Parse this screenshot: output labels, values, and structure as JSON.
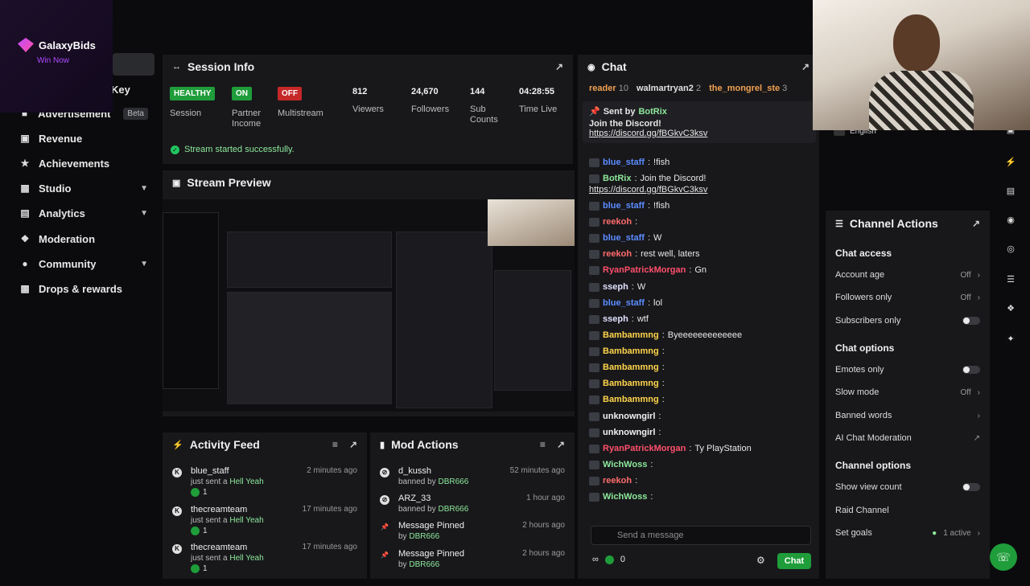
{
  "overlay": {
    "brand": "GalaxyBids",
    "tagline": "Win Now"
  },
  "sidebar": {
    "key_label": "Key",
    "items": [
      {
        "label": "Advertisement",
        "icon": "megaphone-icon",
        "badge": "Beta"
      },
      {
        "label": "Revenue",
        "icon": "chart-icon"
      },
      {
        "label": "Achievements",
        "icon": "trophy-icon"
      },
      {
        "label": "Studio",
        "icon": "film-icon"
      },
      {
        "label": "Analytics",
        "icon": "bar-chart-icon"
      },
      {
        "label": "Moderation",
        "icon": "wrench-icon"
      },
      {
        "label": "Community",
        "icon": "people-icon"
      },
      {
        "label": "Drops & rewards",
        "icon": "gift-icon"
      }
    ]
  },
  "session": {
    "title": "Session Info",
    "stats": [
      {
        "value": "HEALTHY",
        "label": "Session",
        "kind": "badge-green"
      },
      {
        "value": "ON",
        "label": "Partner Income",
        "kind": "badge-green"
      },
      {
        "value": "OFF",
        "label": "Multistream",
        "kind": "badge-red"
      },
      {
        "value": "812",
        "label": "Viewers",
        "kind": "text"
      },
      {
        "value": "24,670",
        "label": "Followers",
        "kind": "text"
      },
      {
        "value": "144",
        "label": "Sub Counts",
        "kind": "text"
      },
      {
        "value": "04:28:55",
        "label": "Time Live",
        "kind": "text"
      }
    ],
    "status": "Stream started successfully."
  },
  "preview": {
    "title": "Stream Preview"
  },
  "activity": {
    "title": "Activity Feed",
    "items": [
      {
        "name": "blue_staff",
        "action": "just sent a",
        "item": "Hell Yeah",
        "count": "1",
        "time": "2 minutes ago"
      },
      {
        "name": "thecreamteam",
        "action": "just sent a",
        "item": "Hell Yeah",
        "count": "1",
        "time": "17 minutes ago"
      },
      {
        "name": "thecreamteam",
        "action": "just sent a",
        "item": "Hell Yeah",
        "count": "1",
        "time": "17 minutes ago"
      }
    ]
  },
  "mod": {
    "title": "Mod Actions",
    "items": [
      {
        "name": "d_kussh",
        "action": "banned by",
        "by": "DBR666",
        "time": "52 minutes ago",
        "icon": "ban-icon"
      },
      {
        "name": "ARZ_33",
        "action": "banned by",
        "by": "DBR666",
        "time": "1 hour ago",
        "icon": "ban-icon"
      },
      {
        "name": "Message Pinned",
        "action": "by",
        "by": "DBR666",
        "time": "2 hours ago",
        "icon": "pin-icon"
      },
      {
        "name": "Message Pinned",
        "action": "by",
        "by": "DBR666",
        "time": "2 hours ago",
        "icon": "pin-icon"
      }
    ]
  },
  "chat": {
    "title": "Chat",
    "leaderboard": [
      {
        "name": "reader",
        "count": "10"
      },
      {
        "name": "walmartryan2",
        "count": "2"
      },
      {
        "name": "the_mongrel_ste",
        "count": "3"
      }
    ],
    "pinned": {
      "sent_by": "Sent by",
      "author": "BotRix",
      "text": "Join the Discord!",
      "link": "https://discord.gg/fBGkvC3ksv"
    },
    "messages": [
      {
        "user": "blue_staff",
        "text": "!fish",
        "color": "#5b8cff"
      },
      {
        "user": "BotRix",
        "text": "Join the Discord!",
        "color": "#8ee99b",
        "link": "https://discord.gg/fBGkvC3ksv"
      },
      {
        "user": "blue_staff",
        "text": "!fish",
        "color": "#5b8cff"
      },
      {
        "user": "reekoh",
        "text": "",
        "color": "#ff6b6b"
      },
      {
        "user": "blue_staff",
        "text": "W",
        "color": "#5b8cff"
      },
      {
        "user": "reekoh",
        "text": "rest well, laters",
        "color": "#ff6b6b"
      },
      {
        "user": "RyanPatrickMorgan",
        "text": "Gn",
        "color": "#ff4f6a"
      },
      {
        "user": "sseph",
        "text": "W",
        "color": "#e0e0ff"
      },
      {
        "user": "blue_staff",
        "text": "lol",
        "color": "#5b8cff"
      },
      {
        "user": "sseph",
        "text": "wtf",
        "color": "#e0e0ff"
      },
      {
        "user": "Bambammng",
        "text": "Byeeeeeeeeeeeee",
        "color": "#ffd54a"
      },
      {
        "user": "Bambammng",
        "text": "",
        "color": "#ffd54a"
      },
      {
        "user": "Bambammng",
        "text": "",
        "color": "#ffd54a"
      },
      {
        "user": "Bambammng",
        "text": "",
        "color": "#ffd54a"
      },
      {
        "user": "Bambammng",
        "text": "",
        "color": "#ffd54a"
      },
      {
        "user": "unknowngirl",
        "text": "",
        "color": "#f2f2f2"
      },
      {
        "user": "unknowngirl",
        "text": "",
        "color": "#f2f2f2"
      },
      {
        "user": "RyanPatrickMorgan",
        "text": "Ty PlayStation",
        "color": "#ff4f6a"
      },
      {
        "user": "WichWoss",
        "text": "",
        "color": "#8ee99b"
      },
      {
        "user": "reekoh",
        "text": "",
        "color": "#ff6b6b"
      },
      {
        "user": "WichWoss",
        "text": "",
        "color": "#8ee99b"
      }
    ],
    "input_placeholder": "Send a message",
    "points": "0",
    "send_label": "Chat"
  },
  "channel_actions": {
    "title": "Channel Actions",
    "language": "English",
    "chat_access": "Chat access",
    "account_age": "Account age",
    "account_age_val": "Off",
    "followers_only": "Followers only",
    "followers_only_val": "Off",
    "subscribers_only": "Subscribers only",
    "chat_options": "Chat options",
    "emotes_only": "Emotes only",
    "slow_mode": "Slow mode",
    "slow_mode_val": "Off",
    "banned_words": "Banned words",
    "ai_moderation": "AI Chat Moderation",
    "channel_options": "Channel options",
    "show_view_count": "Show view count",
    "raid_channel": "Raid Channel",
    "set_goals": "Set goals",
    "set_goals_val": "1 active"
  },
  "colors": {
    "accent": "#1f9d3a",
    "danger": "#c62828",
    "panel": "#18181b"
  }
}
